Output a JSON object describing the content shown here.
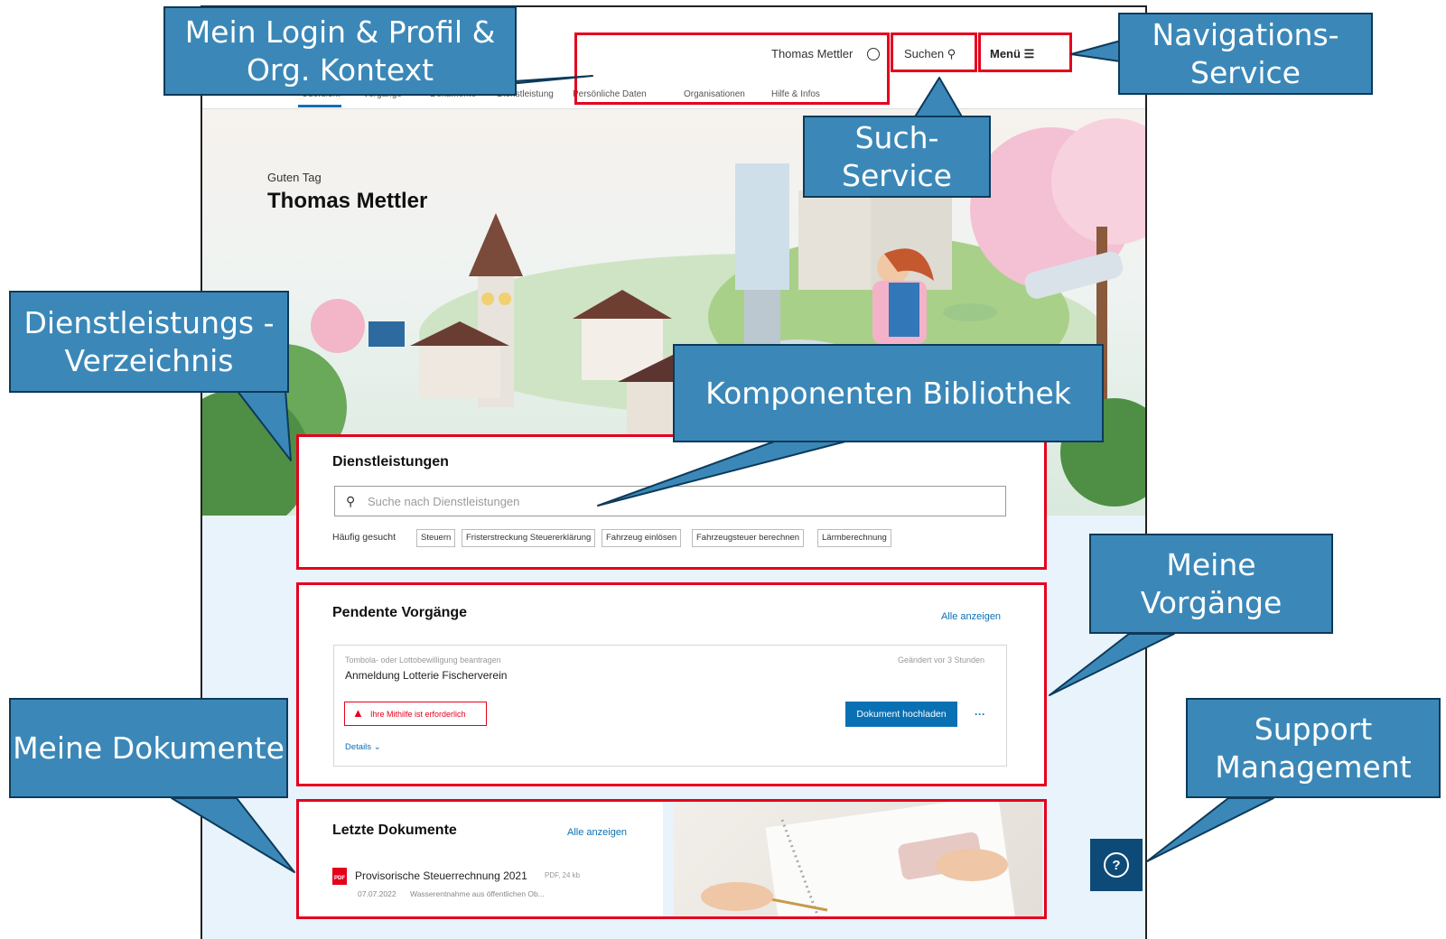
{
  "header": {
    "user_name": "Thomas Mettler",
    "search_label": "Suchen",
    "menu_label": "Menü",
    "tabs": [
      "Übersicht",
      "Vorgänge",
      "Dokumente",
      "Dienstleistung",
      "Persönliche Daten",
      "Organisationen",
      "Hilfe & Infos"
    ]
  },
  "hero": {
    "greeting": "Guten Tag",
    "name": "Thomas Mettler"
  },
  "services": {
    "title": "Dienstleistungen",
    "search_placeholder": "Suche nach Dienstleistungen",
    "frequent_label": "Häufig gesucht",
    "chips": [
      "Steuern",
      "Fristerstreckung Steuererklärung",
      "Fahrzeug einlösen",
      "Fahrzeugsteuer berechnen",
      "Lärmberechnung"
    ]
  },
  "pending": {
    "title": "Pendente Vorgänge",
    "show_all": "Alle anzeigen",
    "item": {
      "subtitle": "Tombola- oder Lottobewilligung beantragen",
      "title": "Anmeldung Lotterie Fischerverein",
      "changed": "Geändert vor 3 Stunden",
      "warning": "Ihre Mithilfe ist erforderlich",
      "action": "Dokument hochladen",
      "more": "···",
      "details": "Details"
    }
  },
  "documents": {
    "title": "Letzte Dokumente",
    "show_all": "Alle anzeigen",
    "file_name": "Provisorische Steuerrechnung 2021",
    "file_meta": "PDF, 24 kb",
    "date": "07.07.2022",
    "description": "Wasserentnahme aus öffentlichen Ob..."
  },
  "callouts": {
    "login": "Mein Login & Profil & Org. Kontext",
    "nav": "Navigations-Service",
    "search": "Such-Service",
    "directory": "Dienstleistungs - Verzeichnis",
    "components": "Komponenten Bibliothek",
    "processes": "Meine Vorgänge",
    "docs": "Meine Dokumente",
    "support": "Support Management"
  },
  "colors": {
    "callout_fill": "#3b88b8",
    "highlight_red": "#e5001c",
    "accent_blue": "#0a70b4"
  }
}
